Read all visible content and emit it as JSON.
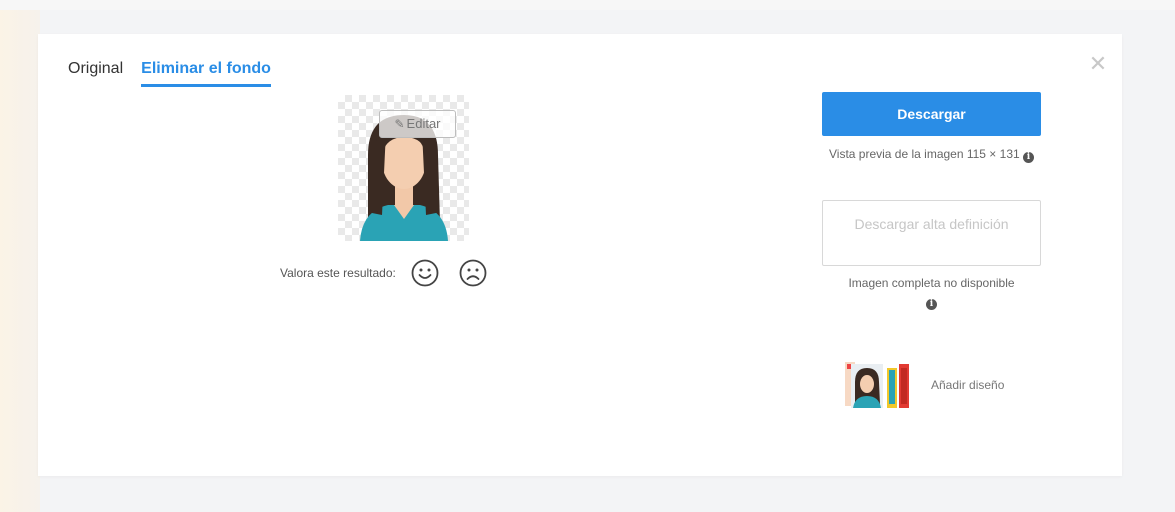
{
  "tabs": [
    {
      "label": "Original",
      "active": false
    },
    {
      "label": "Eliminar el fondo",
      "active": true
    }
  ],
  "close_icon": "close-icon",
  "preview": {
    "edit_label": "Editar",
    "edit_icon": "pencil-icon"
  },
  "rating": {
    "label": "Valora este resultado:",
    "happy_icon": "smiley-icon",
    "sad_icon": "frown-icon"
  },
  "download": {
    "button_label": "Descargar",
    "preview_info": "Vista previa de la imagen 115 × 131",
    "hd_button_label": "Descargar alta definición",
    "hd_info": "Imagen completa no disponible",
    "info_icon": "info-icon"
  },
  "design": {
    "label": "Añadir diseño",
    "thumb_icon": "design-thumbnail"
  },
  "colors": {
    "accent": "#2a8de6",
    "background": "#f3f4f6",
    "card": "#ffffff"
  }
}
